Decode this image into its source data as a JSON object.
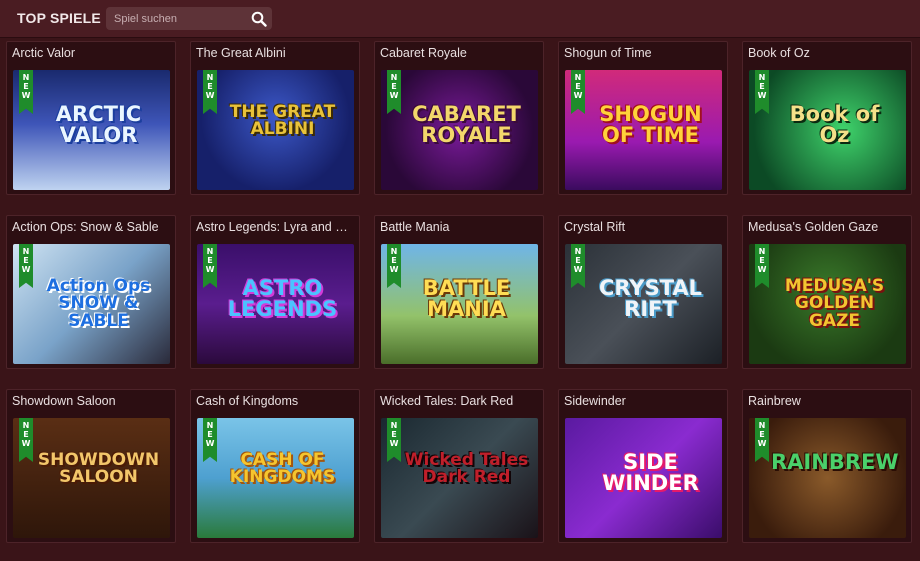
{
  "header": {
    "title": "TOP SPIELE",
    "search": {
      "placeholder": "Spiel suchen",
      "value": "",
      "icon": "search-icon"
    }
  },
  "games": [
    {
      "name": "Arctic Valor",
      "badge": "NEW",
      "art": "ARCTIC VALOR"
    },
    {
      "name": "The Great Albini",
      "badge": "NEW",
      "art": "THE GREAT ALBINI"
    },
    {
      "name": "Cabaret Royale",
      "badge": "NEW",
      "art": "CABARET ROYALE"
    },
    {
      "name": "Shogun of Time",
      "badge": "NEW",
      "art": "SHOGUN OF TIME"
    },
    {
      "name": "Book of Oz",
      "badge": "NEW",
      "art": "Book of Oz"
    },
    {
      "name": "Action Ops: Snow & Sable",
      "badge": "NEW",
      "art": "Action Ops SNOW & SABLE"
    },
    {
      "name": "Astro Legends: Lyra and Erion",
      "badge": "NEW",
      "art": "ASTRO LEGENDS"
    },
    {
      "name": "Battle Mania",
      "badge": "NEW",
      "art": "BATTLE MANIA"
    },
    {
      "name": "Crystal Rift",
      "badge": "NEW",
      "art": "CRYSTAL RIFT"
    },
    {
      "name": "Medusa's Golden Gaze",
      "badge": "NEW",
      "art": "MEDUSA'S GOLDEN GAZE"
    },
    {
      "name": "Showdown Saloon",
      "badge": "NEW",
      "art": "SHOWDOWN SALOON"
    },
    {
      "name": "Cash of Kingdoms",
      "badge": "NEW",
      "art": "CASH OF KINGDOMS"
    },
    {
      "name": "Wicked Tales: Dark Red",
      "badge": "NEW",
      "art": "Wicked Tales Dark Red"
    },
    {
      "name": "Sidewinder",
      "badge": "",
      "art": "SIDE WINDER"
    },
    {
      "name": "Rainbrew",
      "badge": "NEW",
      "art": "RAINBREW"
    }
  ],
  "colors": {
    "page_bg": "#3a1418",
    "header_bg": "#4a1c22",
    "badge_green": "#1f8c2b"
  },
  "thumbs": [
    {
      "bg": "linear-gradient(180deg,#1a2a6e 0%,#3e55b8 45%,#bfd3f0 100%)",
      "color": "#eaf6ff",
      "shadow": "#1b3e9e"
    },
    {
      "bg": "radial-gradient(circle at 50% 40%,#3c58c8 0%,#16206a 70%)",
      "color": "#e8c23a",
      "shadow": "#3a2a05"
    },
    {
      "bg": "radial-gradient(circle at 50% 50%,#7a1a9a 0%,#2a0838 75%)",
      "color": "#f3d76b",
      "shadow": "#3b0a3a"
    },
    {
      "bg": "linear-gradient(180deg,#d12a7a 0%,#9a1ab0 60%,#3a0b5e 100%)",
      "color": "#ffd23a",
      "shadow": "#a10f1f"
    },
    {
      "bg": "radial-gradient(circle at 60% 50%,#3fd36b 0%,#0c4a25 80%)",
      "color": "#f4e089",
      "shadow": "#0b2a10"
    },
    {
      "bg": "linear-gradient(135deg,#cfe3f2 0%,#7aa3c9 50%,#2a2a3a 100%)",
      "color": "#1e6fe0",
      "shadow": "#ffffff"
    },
    {
      "bg": "linear-gradient(180deg,#3a0f6a 0%,#5a1d8e 50%,#2b0a3c 100%)",
      "color": "#4bc3ff",
      "shadow": "#d23bd9"
    },
    {
      "bg": "linear-gradient(180deg,#6fb5e8 0%,#93c26a 60%,#4a6e2a 100%)",
      "color": "#ffdd55",
      "shadow": "#6a3a0a"
    },
    {
      "bg": "linear-gradient(135deg,#2b3138 0%,#4a5058 50%,#1c2026 100%)",
      "color": "#f0f4f8",
      "shadow": "#4a9ac7"
    },
    {
      "bg": "radial-gradient(circle at 50% 40%,#3a7a2a 0%,#1b3a12 75%)",
      "color": "#f2c531",
      "shadow": "#7a1010"
    },
    {
      "bg": "linear-gradient(180deg,#5a2e14 0%,#2e160a 100%)",
      "color": "#f2c66a",
      "shadow": "#4a1a05"
    },
    {
      "bg": "linear-gradient(180deg,#7ac4e8 0%,#4ea0d0 50%,#2a7a3a 100%)",
      "color": "#f6c52e",
      "shadow": "#a2560e"
    },
    {
      "bg": "linear-gradient(135deg,#1a2830 0%,#3a4a52 50%,#1a1218 100%)",
      "color": "#c01f2a",
      "shadow": "#120407"
    },
    {
      "bg": "linear-gradient(135deg,#5a1aa0 0%,#8a2bd0 50%,#3a0d6a 100%)",
      "color": "#ffffff",
      "shadow": "#e61a6a"
    },
    {
      "bg": "radial-gradient(circle at 50% 50%,#8a5a2a 0%,#3a1c0c 80%)",
      "color": "#4ad06a",
      "shadow": "#2a0d04"
    }
  ]
}
